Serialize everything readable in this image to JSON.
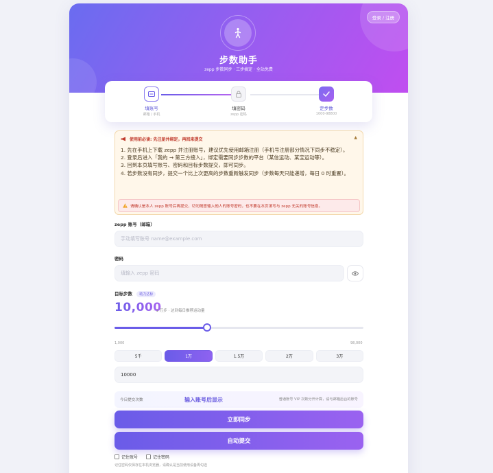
{
  "header": {
    "login_label": "登录 / 注册",
    "title": "步数助手",
    "subtitle": "zepp 步数同步 · 三步搞定 · 全站免费"
  },
  "steps": [
    {
      "title": "填账号",
      "sub": "邮箱 / 手机",
      "icon": "id-card-icon"
    },
    {
      "title": "填密码",
      "sub": "zepp 密码",
      "icon": "lock-icon"
    },
    {
      "title": "定步数",
      "sub": "1000-98800",
      "icon": "check-icon"
    }
  ],
  "notice": {
    "title": "使用前必读: 先注册并绑定，再回来提交",
    "toggle": "▲",
    "items": [
      "1. 先在手机上下载 zepp 并注册账号，建议优先使用邮箱注册（手机号注册部分情况下同步不稳定）。",
      "2. 登录后进入「我的 → 第三方接入」，绑定需要同步步数的平台（某信运动、某宝运动等）。",
      "3. 回到本页填写账号、密码和目标步数提交，即可同步。",
      "4. 若步数没有同步，提交一个比上次更高的步数重新触发同步（步数每天只能递增，每日 0 时重置）。"
    ],
    "warning": "请确认是本人 zepp 账号后再提交，切勿随意输入他人的账号密码，也不要在本页填写与 zepp 无关的账号信息。"
  },
  "form": {
    "account_label": "zepp 账号（邮箱）",
    "account_placeholder": "手动填写账号 name@example.com",
    "password_label": "密码",
    "password_placeholder": "填输入 zepp 密码",
    "target_label": "目标步数",
    "target_tag": "助力达标",
    "steps_display": "10,000",
    "steps_hint": "· 1 万步 · 达到每日推荐运动量",
    "slider": {
      "min_label": "1,000",
      "max_label": "98,000",
      "min": 1000,
      "max": 98000,
      "value": 10000
    },
    "presets": [
      "5千",
      "1万",
      "1.5万",
      "2万",
      "3万"
    ],
    "active_preset": 1,
    "steps_value": "10000"
  },
  "status": {
    "left": "今日提交次数",
    "mid": "输入账号后显示",
    "right": "普通账号 VIP 次数分开计算，请与邮箱后台的账号"
  },
  "buttons": {
    "sync": "立即同步",
    "auto": "自动提交"
  },
  "remember": {
    "account": "记住账号",
    "password": "记住密码",
    "footnote": "记住密码仅保存在本机浏览器，请确认是当前使用设备再勾选"
  },
  "colors": {
    "accent": "#6a5ce8",
    "accent2": "#a864f0",
    "warning": "#c0392b"
  }
}
